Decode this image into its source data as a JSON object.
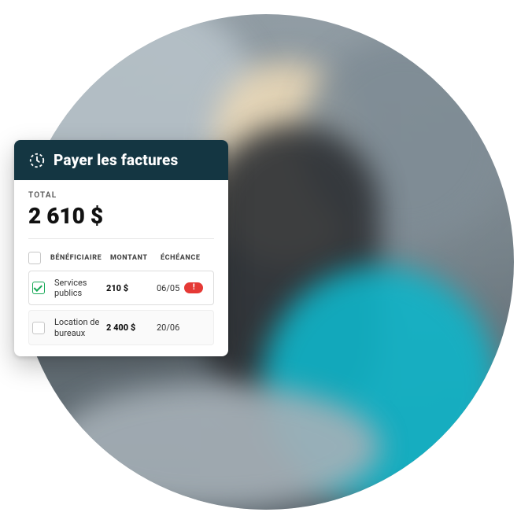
{
  "card": {
    "title": "Payer les factures",
    "total_label": "TOTAL",
    "total_value": "2 610 $",
    "columns": {
      "payee": "BÉNÉFICIAIRE",
      "amount": "MONTANT",
      "due": "ÉCHÉANCE"
    },
    "rows": [
      {
        "checked": true,
        "payee": "Services publics",
        "amount": "210 $",
        "due": "06/05",
        "alert": true
      },
      {
        "checked": false,
        "payee": "Location de bureaux",
        "amount": "2 400 $",
        "due": "20/06",
        "alert": false
      }
    ],
    "alert_glyph": "!"
  }
}
